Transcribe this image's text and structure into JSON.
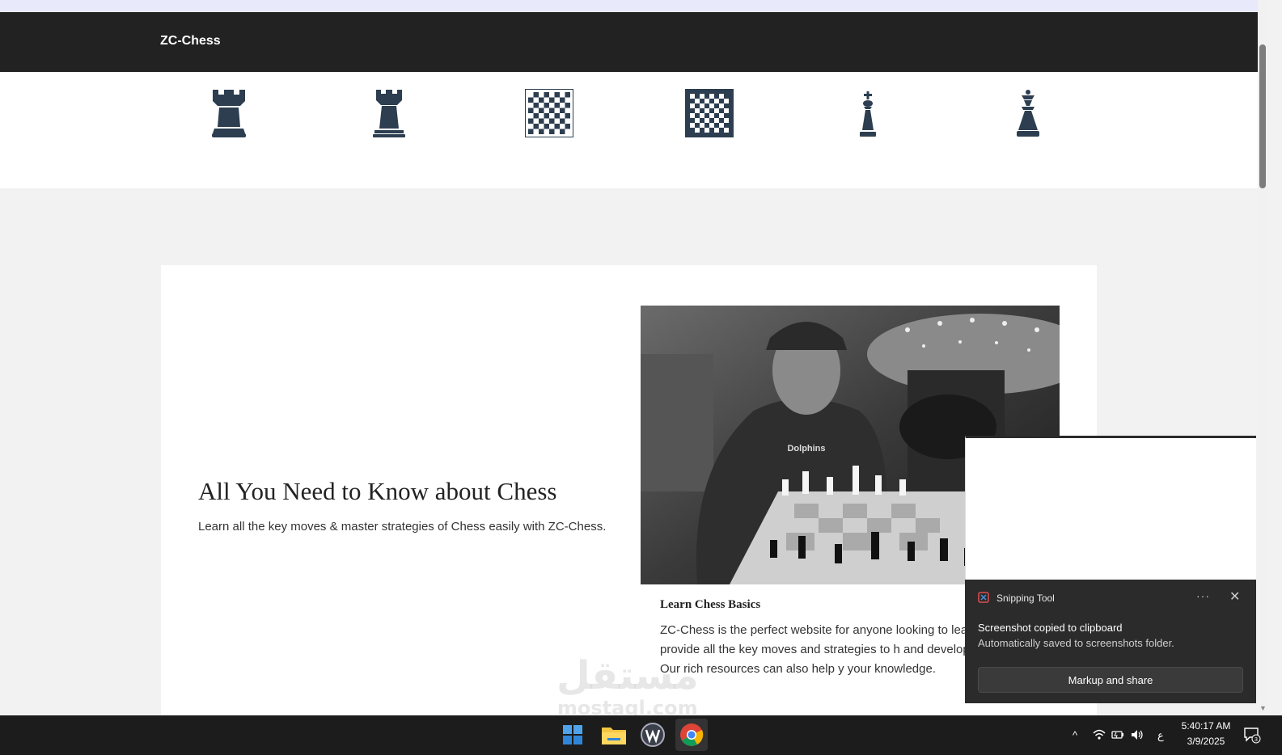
{
  "navbar": {
    "brand": "ZC-Chess"
  },
  "icons": [
    "rook-icon",
    "rook-icon",
    "chessboard-icon",
    "chessboard-icon",
    "king-icon",
    "queen-icon"
  ],
  "hero": {
    "title": "All You Need to Know about Chess",
    "subtitle": "Learn all the key moves & master strategies of Chess easily with ZC-Chess."
  },
  "basics": {
    "title": "Learn Chess Basics",
    "text": "ZC-Chess is the perfect website for anyone looking to lear of chess. We provide all the key moves and strategies to h and develop your skills. Our rich resources can also help y your knowledge."
  },
  "watermark": {
    "arabic": "مستقل",
    "latin": "mostaql.com"
  },
  "toast": {
    "app_name": "Snipping Tool",
    "more": "···",
    "close": "✕",
    "title": "Screenshot copied to clipboard",
    "text": "Automatically saved to screenshots folder.",
    "button": "Markup and share"
  },
  "taskbar": {
    "tray_chevron": "^",
    "language": "ع",
    "notification_count": "3",
    "time": "5:40:17 AM",
    "date": "3/9/2025"
  },
  "colors": {
    "icon": "#2c3e50",
    "navbar": "#222222",
    "toast": "#2b2b2b"
  }
}
